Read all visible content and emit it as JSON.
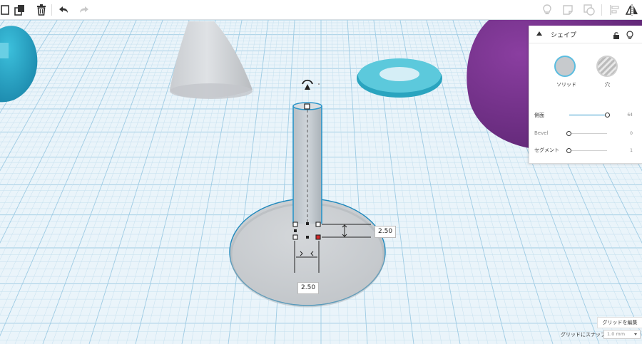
{
  "colors": {
    "grid_bg": "#eaf4fa",
    "grid_line": "#c4dfee",
    "grid_major": "#9ecbe3",
    "teal_shape": "#2ba7c6",
    "purple_shape": "#6a2a7d",
    "cone_gray": "#d4d7da",
    "selection": "#2b95c9",
    "handle_red": "#d42a2a"
  },
  "toolbar": {
    "icons": [
      "copy-icon",
      "duplicate-icon",
      "delete-icon",
      "undo-icon",
      "redo-icon",
      "light-icon",
      "note-icon",
      "group-icon",
      "align-icon",
      "mirror-icon"
    ]
  },
  "shape_panel": {
    "title": "シェイプ",
    "solid_label": "ソリッド",
    "hole_label": "穴",
    "sliders": [
      {
        "label": "側面",
        "value": "64",
        "fraction": 1.0
      },
      {
        "label": "Bevel",
        "value": "0",
        "fraction": 0.0
      },
      {
        "label": "セグメント",
        "value": "1",
        "fraction": 0.0
      }
    ]
  },
  "dimensions": {
    "height_value": "2.50",
    "width_value": "2.50"
  },
  "bottom_bar": {
    "edit_grid_label": "グリッドを編集",
    "snap_label": "グリッドにスナップ",
    "snap_value": "1.0 mm"
  }
}
